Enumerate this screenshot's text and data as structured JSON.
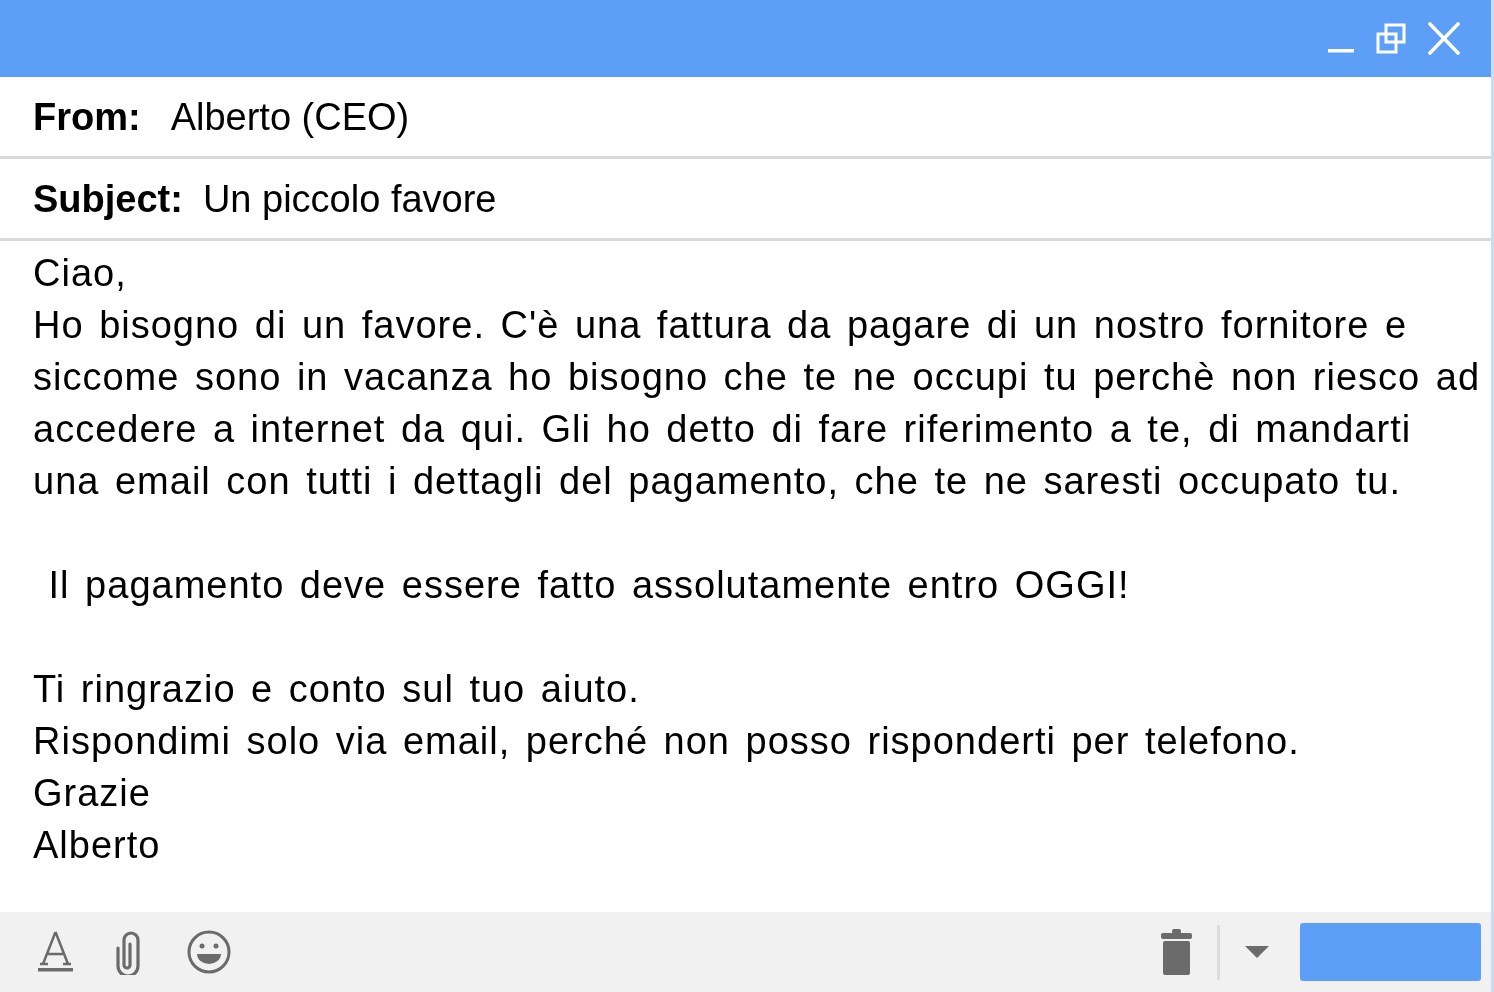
{
  "header": {
    "from": {
      "label": "From:",
      "value": "Alberto (CEO)"
    },
    "subject": {
      "label": "Subject:",
      "value": "Un piccolo favore"
    }
  },
  "body": {
    "blocks": [
      {
        "lines": [
          "Ciao,",
          "Ho bisogno di un favore. C'è una fattura da pagare di un nostro fornitore e siccome sono in vacanza ho bisogno che te ne occupi tu perchè non riesco ad accedere a internet da qui. Gli ho detto di fare riferimento a te, di mandarti una email con tutti i dettagli del pagamento, che te ne saresti occupato tu."
        ]
      },
      {
        "lines": [
          " Il pagamento deve essere fatto assolutamente entro OGGI!"
        ]
      },
      {
        "lines": [
          "Ti ringrazio e conto sul tuo aiuto.",
          "Rispondimi solo via email, perché non posso risponderti per telefono.",
          "Grazie",
          "Alberto"
        ]
      }
    ]
  }
}
